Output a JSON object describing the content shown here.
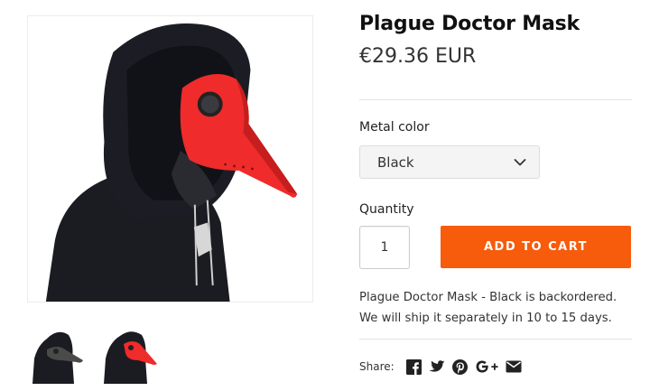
{
  "product": {
    "title": "Plague Doctor Mask",
    "price": "€29.36 EUR",
    "note": "Plague Doctor Mask - Black is backordered. We will ship it separately in 10 to 15 days."
  },
  "options": {
    "color_label": "Metal color",
    "color_value": "Black",
    "quantity_label": "Quantity",
    "quantity_value": "1"
  },
  "cart": {
    "button_label": "ADD TO CART",
    "button_color": "#f75b0c"
  },
  "share": {
    "label": "Share:",
    "icons": [
      "facebook-icon",
      "twitter-icon",
      "pinterest-icon",
      "google-plus-icon",
      "email-icon"
    ]
  },
  "gallery": {
    "main": "red-mask-photo",
    "thumbnails": [
      "black-mask-thumbnail",
      "red-mask-thumbnail"
    ]
  },
  "colors": {
    "mask_red": "#ef2b2b",
    "hoodie": "#1b1c22"
  }
}
